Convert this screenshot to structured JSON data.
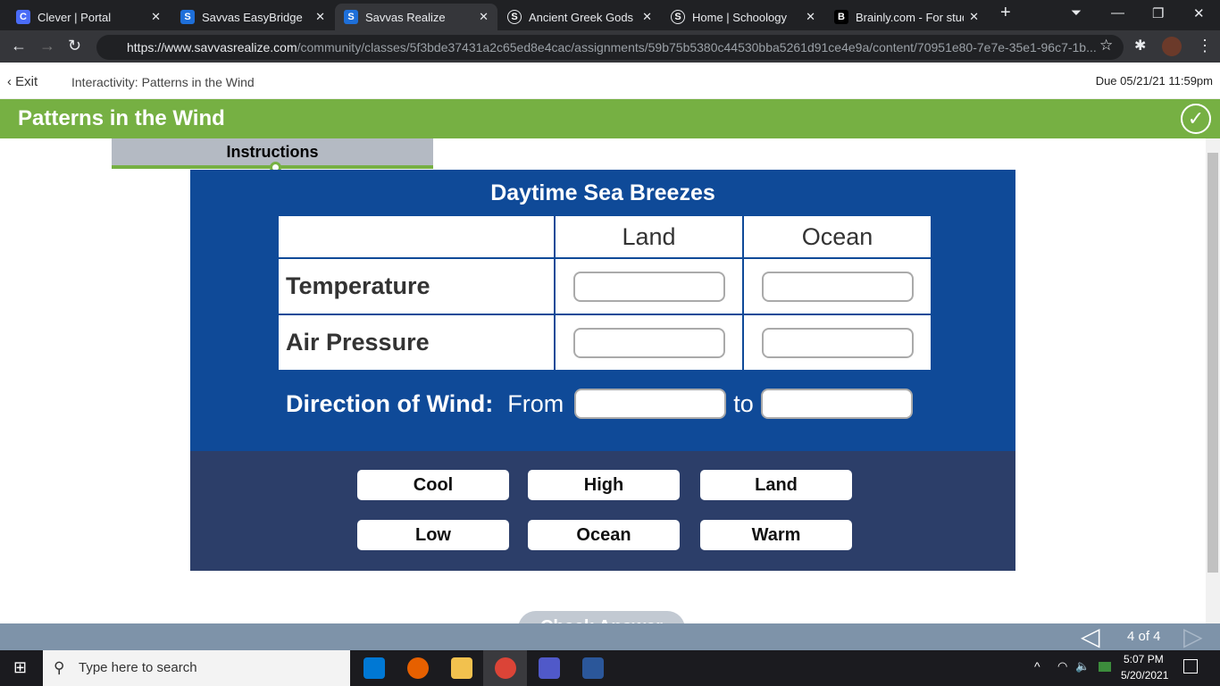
{
  "browser": {
    "tabs": [
      {
        "label": "Clever | Portal",
        "icon": "C",
        "color": "#4a6cf7"
      },
      {
        "label": "Savvas EasyBridge",
        "icon": "S",
        "color": "#1e6fd9"
      },
      {
        "label": "Savvas Realize",
        "icon": "S",
        "color": "#1e6fd9",
        "active": true
      },
      {
        "label": "Ancient Greek Gods Pr",
        "icon": "S",
        "color": "#35363a"
      },
      {
        "label": "Home | Schoology",
        "icon": "S",
        "color": "#35363a"
      },
      {
        "label": "Brainly.com - For stud",
        "icon": "B",
        "color": "#000000"
      }
    ],
    "url_host": "https://www.savvasrealize.com",
    "url_path": "/community/classes/5f3bde37431a2c65ed8e4cac/assignments/59b75b5380c44530bba5261d91ce4e9a/content/70951e80-7e7e-35e1-96c7-1b..."
  },
  "header": {
    "exit": "Exit",
    "breadcrumb": "Interactivity: Patterns in the Wind",
    "due": "Due 05/21/21 11:59pm"
  },
  "title": "Patterns in the Wind",
  "instructions_tab": "Instructions",
  "activity": {
    "heading": "Daytime Sea Breezes",
    "columns": [
      "Land",
      "Ocean"
    ],
    "rows": [
      "Temperature",
      "Air Pressure"
    ],
    "direction_label": "Direction of Wind:",
    "from": "From",
    "to": "to"
  },
  "word_bank": [
    "Cool",
    "High",
    "Land",
    "Low",
    "Ocean",
    "Warm"
  ],
  "check_answer": "Check Answer",
  "pager": "4 of 4",
  "taskbar": {
    "search_placeholder": "Type here to search",
    "time": "5:07 PM",
    "date": "5/20/2021"
  },
  "colors": {
    "green": "#76b043",
    "panel": "#0f4a98",
    "bank": "#2c3e69"
  }
}
